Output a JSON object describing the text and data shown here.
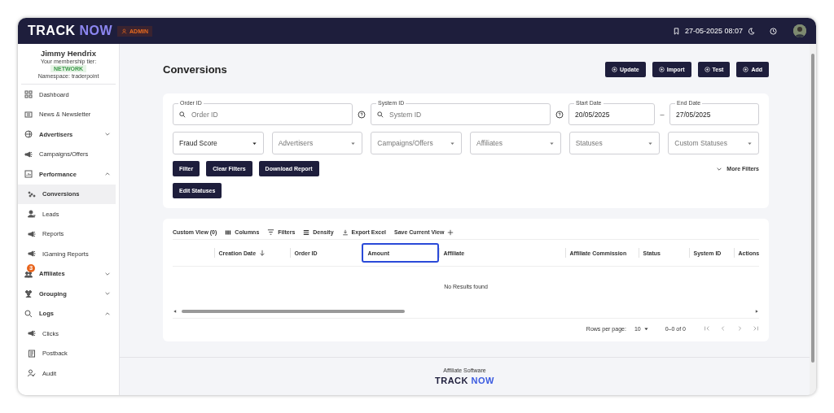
{
  "topbar": {
    "logo": {
      "word": "TRACK",
      "accent": "NOW"
    },
    "role_badge": "ADMIN",
    "datetime": "27-05-2025 08:07"
  },
  "profile": {
    "name": "Jimmy Hendrix",
    "tier_label": "Your membership tier:",
    "tier": "NETWORK",
    "namespace": "Namespace: traderpoint"
  },
  "sidebar": {
    "items": [
      {
        "kind": "link",
        "label": "Dashboard",
        "selected": false
      },
      {
        "kind": "link",
        "label": "News & Newsletter",
        "selected": false
      },
      {
        "kind": "group",
        "label": "Advertisers",
        "expanded": false
      },
      {
        "kind": "link",
        "label": "Campaigns/Offers",
        "selected": false
      },
      {
        "kind": "group",
        "label": "Performance",
        "expanded": true,
        "children": [
          {
            "kind": "link",
            "label": "Conversions",
            "selected": true
          },
          {
            "kind": "link",
            "label": "Leads",
            "selected": false
          },
          {
            "kind": "link",
            "label": "Reports",
            "selected": false
          },
          {
            "kind": "link",
            "label": "IGaming Reports",
            "selected": false
          }
        ]
      },
      {
        "kind": "group",
        "label": "Affiliates",
        "expanded": false,
        "badge": "3"
      },
      {
        "kind": "group",
        "label": "Grouping",
        "expanded": false
      },
      {
        "kind": "group",
        "label": "Logs",
        "expanded": true,
        "children": [
          {
            "kind": "link",
            "label": "Clicks",
            "selected": false
          },
          {
            "kind": "link",
            "label": "Postback",
            "selected": false
          },
          {
            "kind": "link",
            "label": "Audit",
            "selected": false
          }
        ]
      }
    ]
  },
  "page": {
    "title": "Conversions",
    "actions": [
      "Update",
      "Import",
      "Test",
      "Add"
    ]
  },
  "filters": {
    "order_id": {
      "label": "Order ID",
      "placeholder": "Order ID"
    },
    "system_id": {
      "label": "System ID",
      "placeholder": "System ID"
    },
    "start_date": {
      "label": "Start Date",
      "value": "20/05/2025"
    },
    "range_separator": "–",
    "end_date": {
      "label": "End Date",
      "value": "27/05/2025"
    },
    "selects": [
      {
        "label": "Fraud Score",
        "filled": true
      },
      {
        "label": "Advertisers",
        "filled": false
      },
      {
        "label": "Campaigns/Offers",
        "filled": false
      },
      {
        "label": "Affiliates",
        "filled": false
      },
      {
        "label": "Statuses",
        "filled": false
      },
      {
        "label": "Custom Statuses",
        "filled": false
      }
    ],
    "buttons": [
      "Filter",
      "Clear Filters",
      "Download Report"
    ],
    "more_filters": "More Filters",
    "edit_statuses": "Edit Statuses"
  },
  "table": {
    "toolbar": [
      "Custom View (0)",
      "Columns",
      "Filters",
      "Density",
      "Export Excel",
      "Save Current View"
    ],
    "columns": [
      {
        "label": "Creation Date",
        "sorted": true,
        "focused": false
      },
      {
        "label": "Order ID",
        "sorted": false,
        "focused": false
      },
      {
        "label": "Amount",
        "sorted": false,
        "focused": true
      },
      {
        "label": "Affiliate",
        "sorted": false,
        "focused": false
      },
      {
        "label": "Affiliate Commission",
        "sorted": false,
        "focused": false
      },
      {
        "label": "Status",
        "sorted": false,
        "focused": false
      },
      {
        "label": "System ID",
        "sorted": false,
        "focused": false
      },
      {
        "label": "Actions",
        "sorted": false,
        "focused": false
      }
    ],
    "empty_message": "No Results found",
    "pagination": {
      "rows_label": "Rows per page:",
      "rows_value": "10",
      "range": "0–0 of 0"
    }
  },
  "footer": {
    "text": "Affiliate Software",
    "logo": {
      "word": "TRACK",
      "accent": "NOW"
    }
  }
}
